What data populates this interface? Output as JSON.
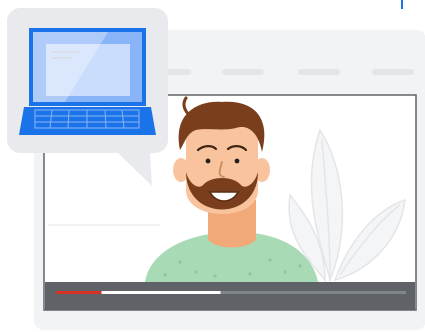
{
  "illustration": {
    "laptop": {
      "icon": "laptop-icon"
    },
    "video_player": {
      "progress_played_fraction": 0.13,
      "progress_buffered_fraction": 0.47,
      "colors": {
        "played": "#d93025",
        "buffered": "#ffffff",
        "bar": "#5f6368"
      }
    },
    "person": {
      "icon": "person-avatar-icon"
    },
    "plant": {
      "icon": "plant-icon"
    },
    "colors": {
      "accent_blue": "#1a73e8",
      "bubble": "#e8eaed",
      "window": "#f1f3f4",
      "skin": "#f9c49d",
      "hair": "#7a3e1d",
      "shirt": "#a8dab5"
    }
  }
}
